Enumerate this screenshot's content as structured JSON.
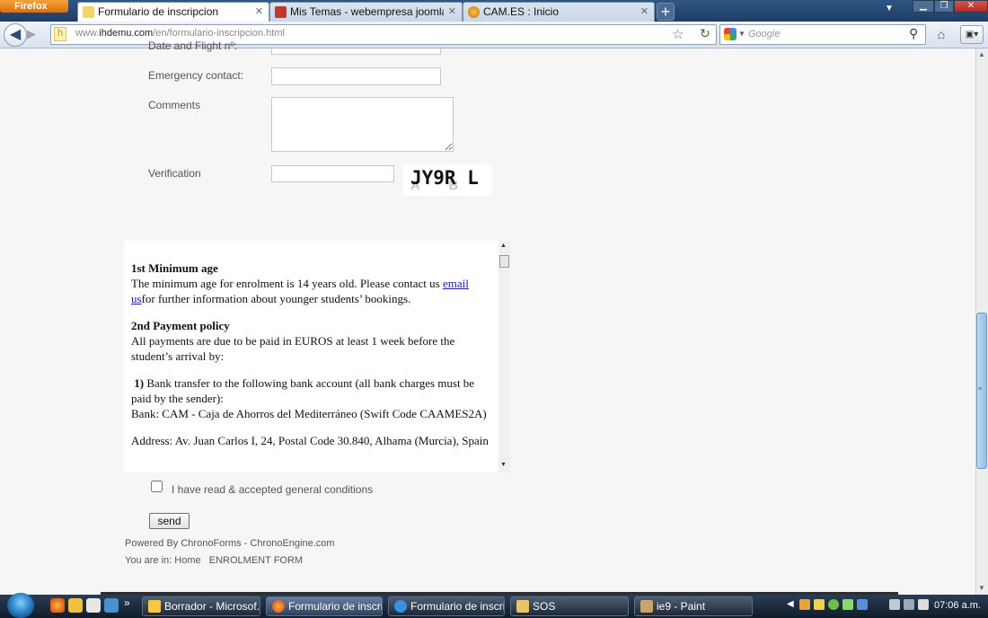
{
  "browser": {
    "menu_button": "Firefox",
    "tabs": [
      {
        "title": "Formulario de inscripcion",
        "active": true
      },
      {
        "title": "Mis Temas - webempresa joomla - H...",
        "active": false
      },
      {
        "title": "CAM.ES : Inicio",
        "active": false
      }
    ],
    "new_tab": "+",
    "url_prefix": "www.",
    "url_domain": "ihdemu.com",
    "url_path": "/en/formulario-inscripcion.html",
    "search_placeholder": "Google"
  },
  "form": {
    "partial_label": "Date and Flight nº:",
    "emergency_label": "Emergency contact:",
    "comments_label": "Comments",
    "verification_label": "Verification",
    "captcha_text": "JY9R L",
    "captcha_bg_letters": "A B X",
    "conditions_label": "I have read & accepted general conditions",
    "send_label": "send",
    "powered_by": "Powered By ChronoForms - ChronoEngine.com",
    "breadcrumb_prefix": "You are in:",
    "breadcrumb_home": "Home",
    "breadcrumb_current": "ENROLMENT FORM"
  },
  "terms": {
    "h1": "1st Minimum age",
    "p1_before": "The minimum age for enrolment is 14 years old. Please contact us ",
    "p1_link": "email us",
    "p1_after": "for further information about younger students’ bookings.",
    "h2": "2nd Payment policy",
    "p2": "All payments are due to be paid in EUROS at least 1 week before the student’s arrival by:",
    "p3_num": "1)",
    "p3": "Bank transfer to the following bank account (all bank charges must be paid by the sender):",
    "p3_bank": "Bank: CAM - Caja de Ahorros del Mediterráneo (Swift Code CAAMES2A)",
    "p4": "Address: Av. Juan Carlos I, 24, Postal Code 30.840, Alhama (Murcia), Spain"
  },
  "taskbar": {
    "items": [
      {
        "label": "Borrador - Microsof...",
        "active": false
      },
      {
        "label": "Formulario de inscri...",
        "active": true
      },
      {
        "label": "Formulario de inscri...",
        "active": false
      },
      {
        "label": "SOS",
        "active": false
      },
      {
        "label": "ie9 - Paint",
        "active": false
      }
    ],
    "overflow": "»",
    "clock": "07:06 a.m."
  },
  "colors": {
    "accent": "#2f5784",
    "link": "#1a1aa6",
    "firefox": "#e8870f"
  }
}
